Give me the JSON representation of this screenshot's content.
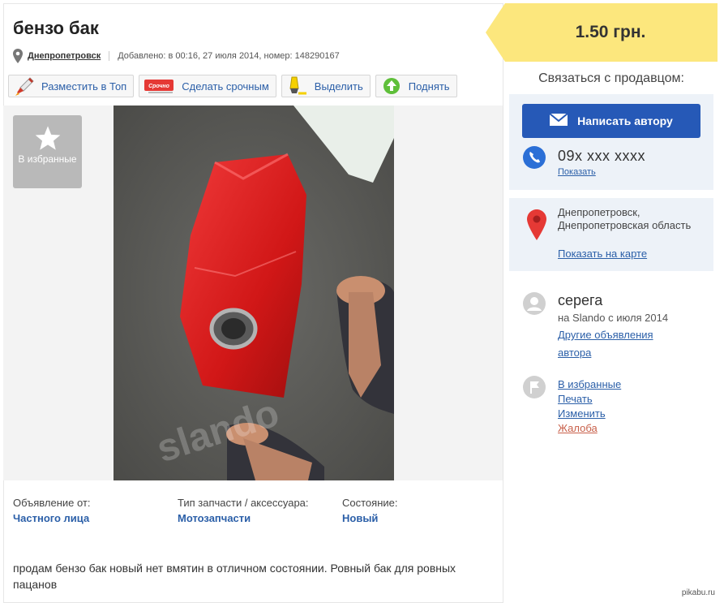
{
  "listing": {
    "title": "бензо бак",
    "city": "Днепропетровск",
    "added": "Добавлено: в 00:16, 27 июля 2014, номер: 148290167"
  },
  "toolbar": {
    "top_label": "Разместить в Топ",
    "urgent_label": "Сделать срочным",
    "urgent_badge": "Срочно",
    "highlight_label": "Выделить",
    "raise_label": "Поднять"
  },
  "gallery": {
    "favorite_label": "В избранные",
    "photo_watermark": "slando"
  },
  "details": [
    {
      "label": "Объявление от:",
      "value": "Частного лица"
    },
    {
      "label": "Тип запчасти / аксессуара:",
      "value": "Мотозапчасти"
    },
    {
      "label": "Состояние:",
      "value": "Новый"
    }
  ],
  "description": "продам бензо бак новый нет вмятин в отличном состоянии. Ровный бак для ровных пацанов",
  "sidebar": {
    "price": "1.50 грн.",
    "contact_heading": "Связаться с продавцом:",
    "message_button": "Написать автору",
    "phone": "09x xxx xxxx",
    "phone_show": "Показать",
    "address": "Днепропетровск, Днепропетровская область",
    "map_link": "Показать на карте",
    "user_name": "серега",
    "user_since": "на Slando с июля 2014",
    "user_other_ads": "Другие объявления автора",
    "favorite": "В избранные",
    "print": "Печать",
    "edit": "Изменить",
    "report": "Жалоба"
  },
  "watermark": "pikabu.ru",
  "colors": {
    "accent_blue": "#2659b7",
    "link_blue": "#2b5fa8",
    "price_yellow": "#fce77d",
    "panel_bg": "#edf2f8",
    "report_red": "#c8604a"
  }
}
